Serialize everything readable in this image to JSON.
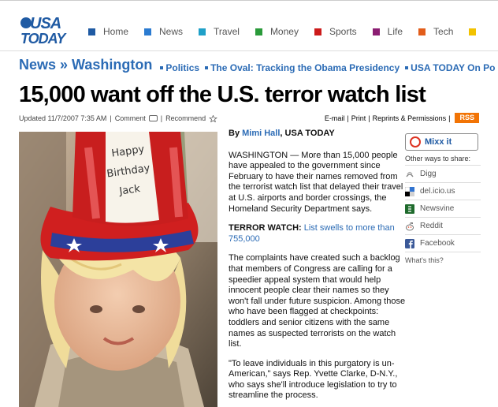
{
  "brand": {
    "line1": "USA",
    "line2": "TODAY"
  },
  "nav": [
    {
      "label": "Home",
      "color": "#1f5aa3"
    },
    {
      "label": "News",
      "color": "#2b7bd1"
    },
    {
      "label": "Travel",
      "color": "#1fa0c8"
    },
    {
      "label": "Money",
      "color": "#2a9a3a"
    },
    {
      "label": "Sports",
      "color": "#cc1b1b"
    },
    {
      "label": "Life",
      "color": "#8b1d72"
    },
    {
      "label": "Tech",
      "color": "#e25d1a"
    }
  ],
  "breadcrumb": {
    "section": "News",
    "separator": "»",
    "subsection": "Washington",
    "subnav": [
      "Politics",
      "The Oval: Tracking the Obama Presidency",
      "USA TODAY On Po"
    ]
  },
  "headline": "15,000 want off the U.S. terror watch list",
  "meta": {
    "updated": "Updated 11/7/2007 7:35 AM",
    "sep": "|",
    "comment": "Comment",
    "recommend": "Recommend"
  },
  "tools": {
    "email": "E-mail",
    "print": "Print",
    "reprints": "Reprints & Permissions",
    "sep": "|",
    "rss": "RSS"
  },
  "byline": {
    "prefix": "By",
    "author": "Mimi Hall",
    "outlet": ", USA TODAY"
  },
  "paragraphs": {
    "p1": "WASHINGTON — More than 15,000 people have appealed to the government since February to have their names removed from the terrorist watch list that delayed their travel at U.S. airports and border crossings, the Homeland Security Department says.",
    "tw_label": "TERROR WATCH:",
    "tw_link": "List swells to more than 755,000",
    "p3": "The complaints have created such a backlog that members of Congress are calling for a speedier appeal system that would help innocent people clear their names so they won't fall under future suspicion. Among those who have been flagged at checkpoints: toddlers and senior citizens with the same names as suspected terrorists on the watch list.",
    "p4": "\"To leave individuals in this purgatory is un-American,\" says Rep. Yvette Clarke, D-N.Y., who says she'll introduce legislation to try to streamline the process."
  },
  "share": {
    "mixx": "Mixx it",
    "other": "Other ways to share:",
    "items": [
      "Digg",
      "del.icio.us",
      "Newsvine",
      "Reddit",
      "Facebook"
    ],
    "whats": "What's this?"
  },
  "photo": {
    "hat_text": [
      "Happy",
      "Birthday",
      "Jack"
    ]
  }
}
